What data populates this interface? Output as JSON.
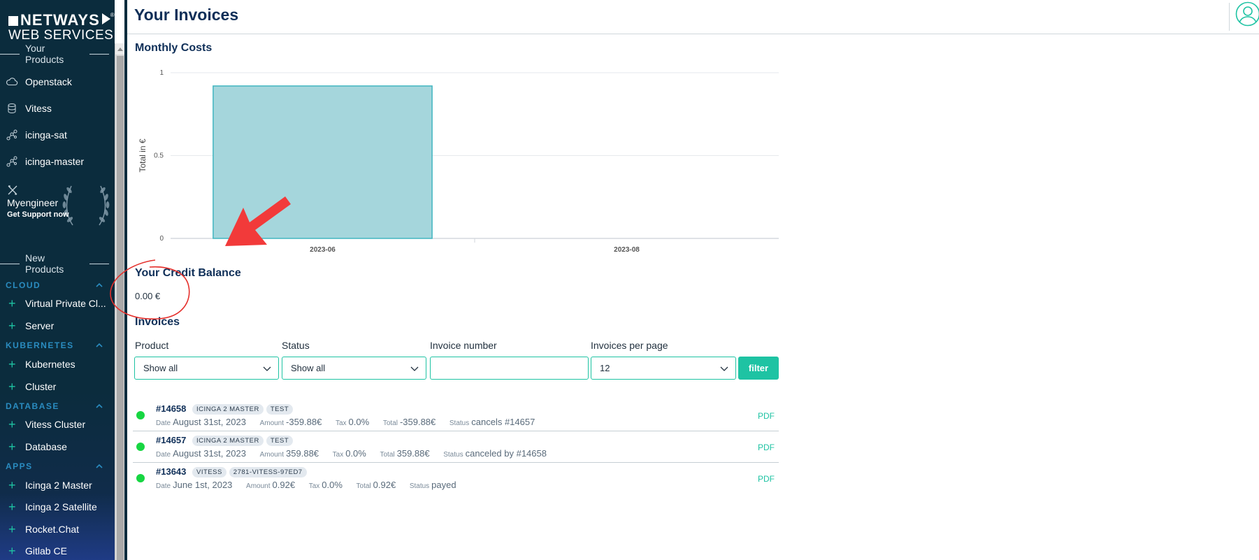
{
  "brand": {
    "line1": "NETWAYS",
    "line2": "WEB SERVICES",
    "reg": "®"
  },
  "sidebar": {
    "your_products_title": "Your Products",
    "your_products": [
      {
        "label": "Openstack",
        "icon": "cloud-icon"
      },
      {
        "label": "Vitess",
        "icon": "database-icon"
      },
      {
        "label": "icinga-sat",
        "icon": "network-icon"
      },
      {
        "label": "icinga-master",
        "icon": "network-icon"
      }
    ],
    "engineer": {
      "name": "Myengineer",
      "support": "Get Support now",
      "icon": "tools-icon"
    },
    "new_products_title": "New Products",
    "categories": [
      {
        "name": "CLOUD",
        "items": [
          "Virtual Private Cl...",
          "Server"
        ]
      },
      {
        "name": "KUBERNETES",
        "items": [
          "Kubernetes",
          "Cluster"
        ]
      },
      {
        "name": "DATABASE",
        "items": [
          "Vitess Cluster",
          "Database"
        ]
      },
      {
        "name": "APPS",
        "items": [
          "Icinga 2 Master",
          "Icinga 2 Satellite",
          "Rocket.Chat",
          "Gitlab CE"
        ]
      }
    ]
  },
  "header": {
    "title": "Your Invoices"
  },
  "monthly_costs": {
    "title": "Monthly Costs"
  },
  "chart_data": {
    "type": "bar",
    "categories": [
      "2023-06",
      "2023-08"
    ],
    "values": [
      0.92,
      0
    ],
    "title": "",
    "xlabel": "",
    "ylabel": "Total in €",
    "ylim": [
      0,
      1
    ],
    "yticks": [
      "0",
      "0.5",
      "1"
    ],
    "grid": true,
    "bar_color": "#a5d6dc",
    "bar_border": "#41b6c0"
  },
  "credit": {
    "title": "Your Credit Balance",
    "value": "0.00 €"
  },
  "invoices": {
    "title": "Invoices",
    "filters": {
      "product_label": "Product",
      "product_value": "Show all",
      "status_label": "Status",
      "status_value": "Show all",
      "number_label": "Invoice number",
      "number_value": "",
      "per_page_label": "Invoices per page",
      "per_page_value": "12",
      "filter_button": "filter"
    },
    "labels": {
      "date": "Date",
      "amount": "Amount",
      "tax": "Tax",
      "total": "Total",
      "status": "Status",
      "pdf": "PDF"
    },
    "rows": [
      {
        "number": "#14658",
        "tags": [
          "ICINGA 2 MASTER",
          "TEST"
        ],
        "date": "August 31st, 2023",
        "amount": "-359.88€",
        "tax": "0.0%",
        "total": "-359.88€",
        "status": "cancels #14657"
      },
      {
        "number": "#14657",
        "tags": [
          "ICINGA 2 MASTER",
          "TEST"
        ],
        "date": "August 31st, 2023",
        "amount": "359.88€",
        "tax": "0.0%",
        "total": "359.88€",
        "status": "canceled by #14658"
      },
      {
        "number": "#13643",
        "tags": [
          "VITESS",
          "2781-VITESS-97ED7"
        ],
        "date": "June 1st, 2023",
        "amount": "0.92€",
        "tax": "0.0%",
        "total": "0.92€",
        "status": "payed"
      }
    ]
  },
  "colors": {
    "accent": "#1ec3a3",
    "sidebar_bg": "#0b2c3d",
    "title": "#0f2f58",
    "status_dot": "#17d642",
    "annotation": "#f23a3a"
  }
}
